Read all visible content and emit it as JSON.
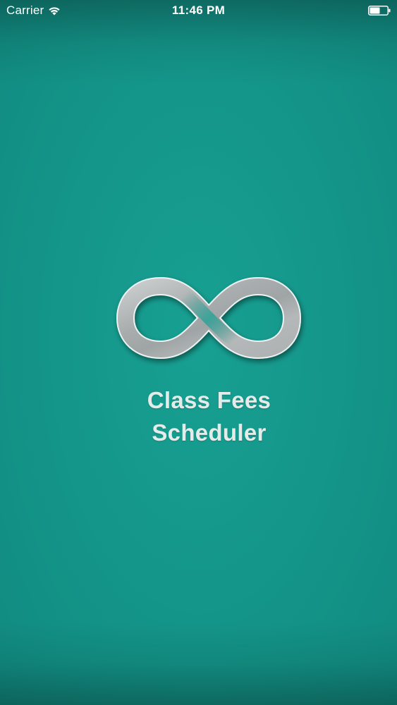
{
  "status_bar": {
    "carrier": "Carrier",
    "time": "11:46 PM",
    "wifi_icon": "wifi-icon",
    "battery_icon": "battery-icon"
  },
  "splash": {
    "logo_icon": "infinity-logo-icon",
    "title_line1": "Class Fees",
    "title_line2": "Scheduler"
  },
  "colors": {
    "background": "#14968a",
    "title_text": "#e4ece9",
    "logo_fill": "#b3b7b8"
  }
}
